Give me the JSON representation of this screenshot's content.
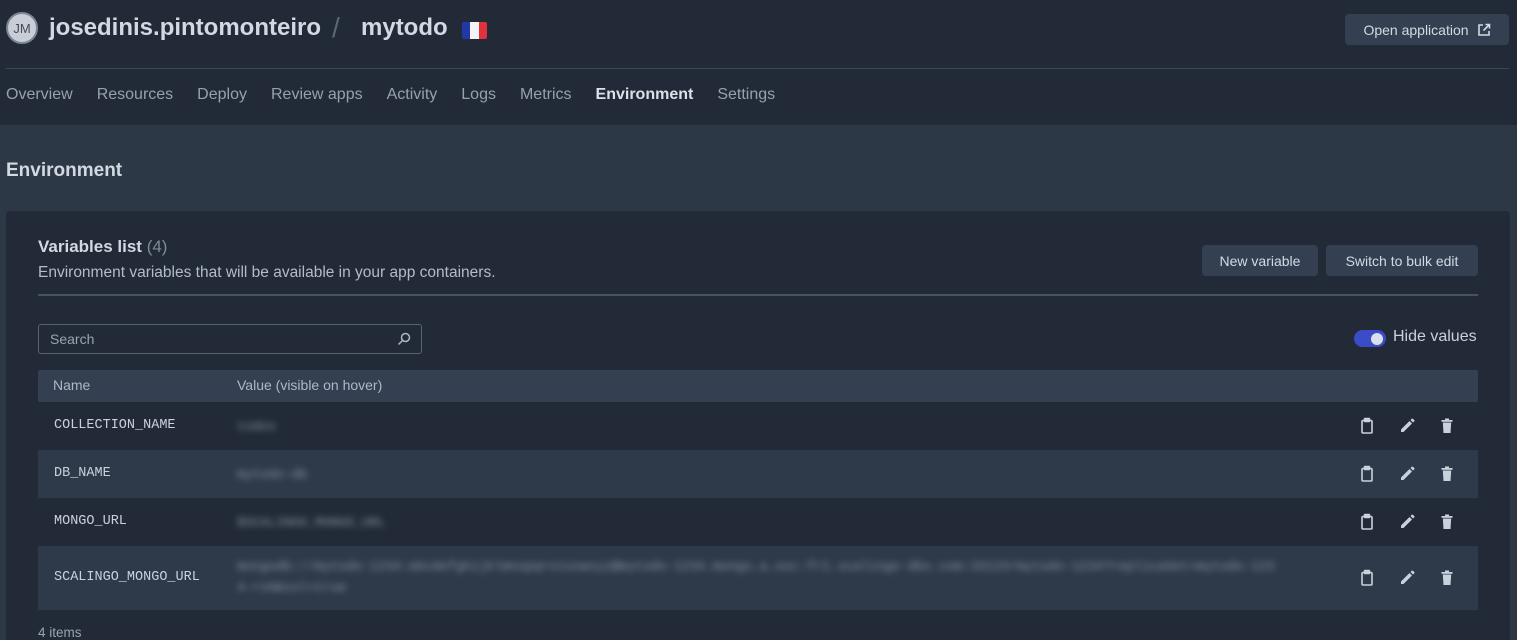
{
  "header": {
    "avatar_initials": "JM",
    "owner": "josedinis.pintomonteiro",
    "separator": "/",
    "app_name": "mytodo",
    "region_flag": "flag-fr-icon",
    "open_application_label": "Open application"
  },
  "nav": {
    "tabs": [
      {
        "label": "Overview",
        "active": false
      },
      {
        "label": "Resources",
        "active": false
      },
      {
        "label": "Deploy",
        "active": false
      },
      {
        "label": "Review apps",
        "active": false
      },
      {
        "label": "Activity",
        "active": false
      },
      {
        "label": "Logs",
        "active": false
      },
      {
        "label": "Metrics",
        "active": false
      },
      {
        "label": "Environment",
        "active": true
      },
      {
        "label": "Settings",
        "active": false
      }
    ]
  },
  "page": {
    "title": "Environment"
  },
  "variables": {
    "title": "Variables list",
    "count": "(4)",
    "subtitle": "Environment variables that will be available in your app containers.",
    "new_variable_label": "New variable",
    "bulk_edit_label": "Switch to bulk edit",
    "search_placeholder": "Search",
    "hide_values_label": "Hide values",
    "hide_values_on": true,
    "columns": {
      "name": "Name",
      "value": "Value (visible on hover)"
    },
    "rows": [
      {
        "name": "COLLECTION_NAME",
        "value": "todos"
      },
      {
        "name": "DB_NAME",
        "value": "mytodo-db"
      },
      {
        "name": "MONGO_URL",
        "value": "$SCALINGO_MONGO_URL"
      },
      {
        "name": "SCALINGO_MONGO_URL",
        "value": "mongodb://mytodo-1234:abcdefghijklmnopqrstuvwxyz@mytodo-1234.mongo.a.osc-fr1.scalingo-dbs.com:33123/mytodo-1234?replicaSet=mytodo-1234-rs0&ssl=true"
      }
    ],
    "footer": "4 items"
  },
  "colors": {
    "accent_toggle": "#3c4bc8",
    "flag_blue": "#2437a6",
    "flag_white": "#f4f4f4",
    "flag_red": "#e0323c"
  }
}
